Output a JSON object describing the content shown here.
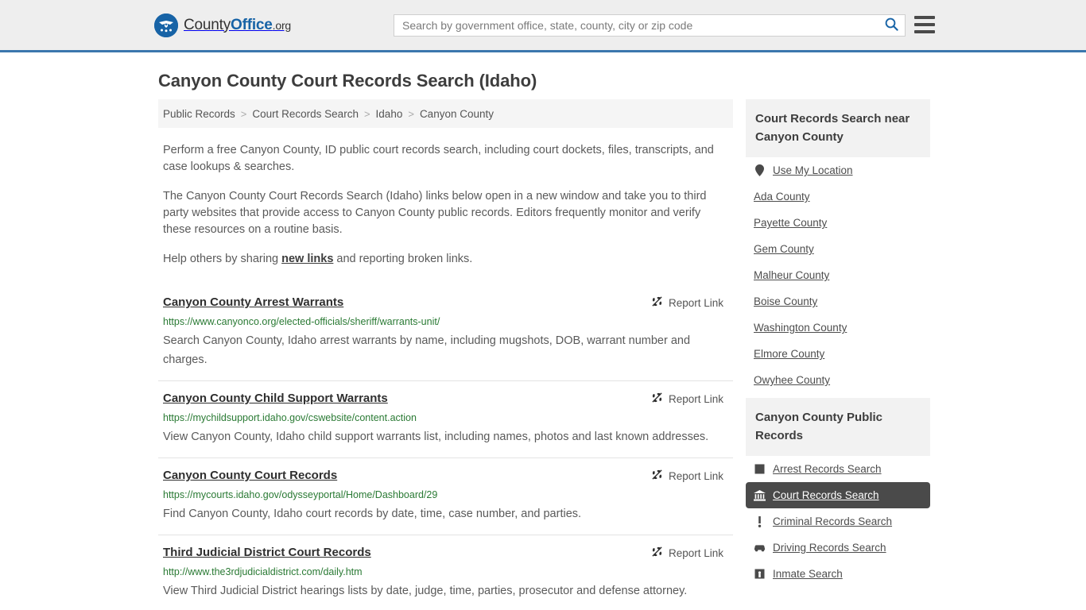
{
  "header": {
    "logo": {
      "icon": "eagle-shield-icon",
      "text_county": "County",
      "text_office": "Office",
      "text_org": ".org"
    },
    "search": {
      "placeholder": "Search by government office, state, county, city or zip code",
      "value": "",
      "search_icon": "search-icon",
      "search_icon_color": "#1763a6"
    },
    "menu": {
      "icon": "hamburger-menu-icon",
      "label": "Menu"
    },
    "background": "#eeeeee",
    "accent_border": "#3b77ad"
  },
  "page": {
    "title": "Canyon County Court Records Search (Idaho)"
  },
  "breadcrumb": {
    "separator": ">",
    "items": [
      {
        "label": "Public Records",
        "current": false
      },
      {
        "label": "Court Records Search",
        "current": false
      },
      {
        "label": "Idaho",
        "current": false
      },
      {
        "label": "Canyon County",
        "current": true
      }
    ]
  },
  "intro": {
    "paragraph1": "Perform a free Canyon County, ID public court records search, including court dockets, files, transcripts, and case lookups & searches.",
    "paragraph2": "The Canyon County Court Records Search (Idaho) links below open in a new window and take you to third party websites that provide access to Canyon County public records. Editors frequently monitor and verify these resources on a routine basis.",
    "paragraph3_before": "Help others by sharing ",
    "paragraph3_link": "new links",
    "paragraph3_after": " and reporting broken links."
  },
  "results": {
    "report_label": "Report Link",
    "report_icon": "broken-link-icon",
    "url_color": "#2a7a34",
    "items": [
      {
        "title": "Canyon County Arrest Warrants",
        "url": "https://www.canyonco.org/elected-officials/sheriff/warrants-unit/",
        "description": "Search Canyon County, Idaho arrest warrants by name, including mugshots, DOB, warrant number and charges."
      },
      {
        "title": "Canyon County Child Support Warrants",
        "url": "https://mychildsupport.idaho.gov/cswebsite/content.action",
        "description": "View Canyon County, Idaho child support warrants list, including names, photos and last known addresses."
      },
      {
        "title": "Canyon County Court Records",
        "url": "https://mycourts.idaho.gov/odysseyportal/Home/Dashboard/29",
        "description": "Find Canyon County, Idaho court records by date, time, case number, and parties."
      },
      {
        "title": "Third Judicial District Court Records",
        "url": "http://www.the3rdjudicialdistrict.com/daily.htm",
        "description": "View Third Judicial District hearings lists by date, judge, time, parties, prosecutor and defense attorney."
      }
    ]
  },
  "sidebar": {
    "nearby": {
      "heading": "Court Records Search near Canyon County",
      "items": [
        {
          "label": "Use My Location",
          "icon": "map-pin-icon"
        },
        {
          "label": "Ada County",
          "icon": ""
        },
        {
          "label": "Payette County",
          "icon": ""
        },
        {
          "label": "Gem County",
          "icon": ""
        },
        {
          "label": "Malheur County",
          "icon": ""
        },
        {
          "label": "Boise County",
          "icon": ""
        },
        {
          "label": "Washington County",
          "icon": ""
        },
        {
          "label": "Elmore County",
          "icon": ""
        },
        {
          "label": "Owyhee County",
          "icon": ""
        }
      ]
    },
    "public_records": {
      "heading": "Canyon County Public Records",
      "active_background": "#4a4a4a",
      "items": [
        {
          "label": "Arrest Records Search",
          "icon": "square-icon",
          "active": false
        },
        {
          "label": "Court Records Search",
          "icon": "courthouse-icon",
          "active": true
        },
        {
          "label": "Criminal Records Search",
          "icon": "exclamation-icon",
          "active": false
        },
        {
          "label": "Driving Records Search",
          "icon": "car-icon",
          "active": false
        },
        {
          "label": "Inmate Search",
          "icon": "jail-icon",
          "active": false
        }
      ]
    }
  }
}
